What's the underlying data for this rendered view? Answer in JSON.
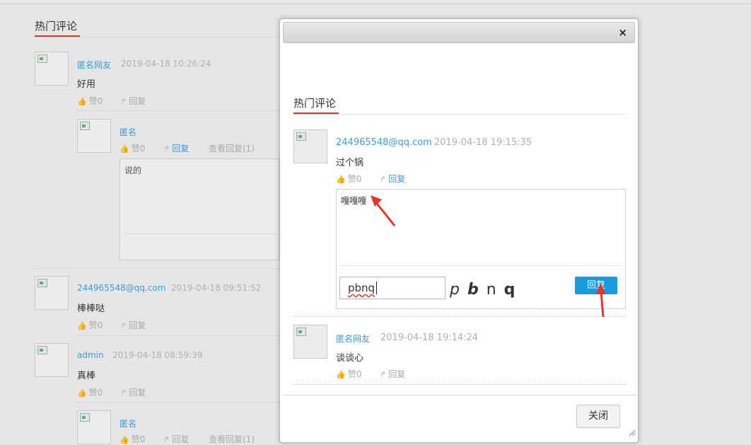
{
  "background": {
    "section_title": "热门评论",
    "comments": [
      {
        "user": "匿名网友",
        "time": "2019-04-18 10:26:24",
        "content": "好用",
        "like": "赞0",
        "reply": "回复"
      },
      {
        "user": "244965548@qq.com",
        "time": "2019-04-18 09:51:52",
        "content": "棒棒哒",
        "like": "赞0",
        "reply": "回复"
      },
      {
        "user": "admin",
        "time": "2019-04-18 08:59:39",
        "content": "真棒",
        "like": "赞0",
        "reply": "回复"
      }
    ],
    "nested_reply": {
      "user": "匿名",
      "like": "赞0",
      "reply": "回复",
      "view_replies": "查看回复(1)",
      "textarea_text": "说的"
    },
    "nested_reply_2": {
      "user": "匿名",
      "like": "赞0",
      "reply": "回复",
      "view_replies": "查看回复(1)"
    }
  },
  "modal": {
    "close_icon": "×",
    "section_title": "热门评论",
    "comments": [
      {
        "user": "244965548@qq.com",
        "time": "2019-04-18 19:15:35",
        "content": "过个锅",
        "like": "赞0",
        "reply": "回复"
      },
      {
        "user": "匿名网友",
        "time": "2019-04-18 19:14:24",
        "content": "谈谈心",
        "like": "赞0",
        "reply": "回复"
      }
    ],
    "reply_textarea_text": "嘎嘎嘎",
    "captcha_input_value": "pbnq",
    "captcha_chars": [
      "p",
      "b",
      "n",
      "q"
    ],
    "reply_button_label": "回复",
    "close_button_label": "关闭"
  },
  "colors": {
    "accent_red": "#d23b30",
    "link_blue": "#3f9bd7",
    "button_blue": "#1a9be0",
    "annotation_arrow": "#e8332a"
  }
}
